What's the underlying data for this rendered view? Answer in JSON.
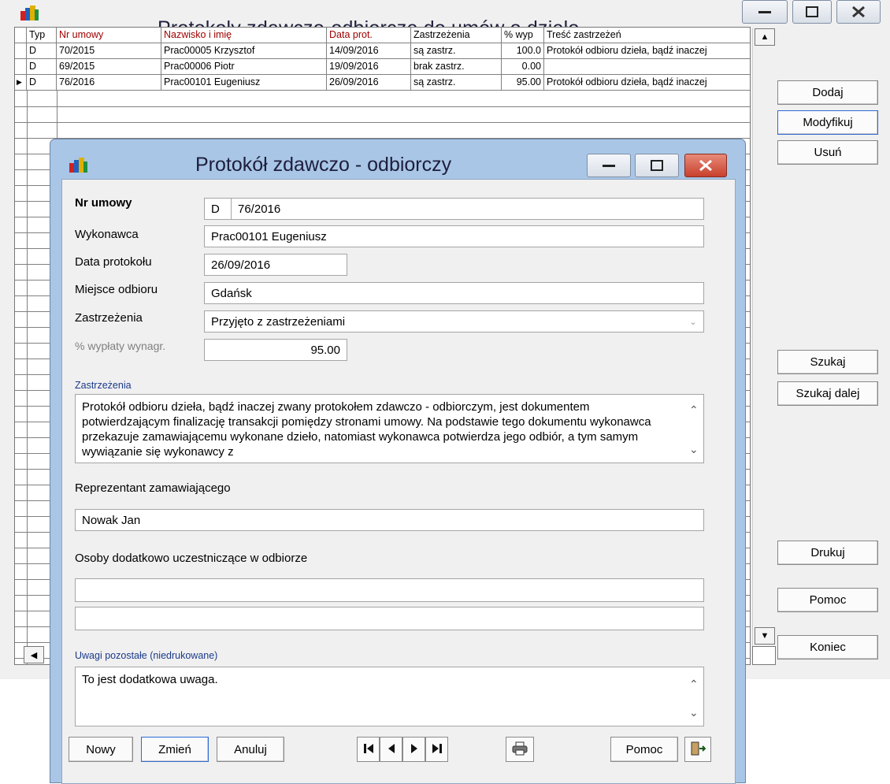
{
  "main": {
    "title": "Protokoły zdawczo-odbiorcze do umów o dzieło",
    "columns": [
      "Typ",
      "Nr umowy",
      "Nazwisko i imię",
      "Data prot.",
      "Zastrzeżenia",
      "% wyp",
      "Treść zastrzeżeń"
    ],
    "rows": [
      {
        "typ": "D",
        "nr": "70/2015",
        "name": "Prac00005 Krzysztof",
        "date": "14/09/2016",
        "zastrz": "są zastrz.",
        "pct": "100.0",
        "tresc": "Protokół odbioru dzieła, bądź inaczej"
      },
      {
        "typ": "D",
        "nr": "69/2015",
        "name": "Prac00006 Piotr",
        "date": "19/09/2016",
        "zastrz": "brak zastrz.",
        "pct": "0.00",
        "tresc": ""
      },
      {
        "typ": "D",
        "nr": "76/2016",
        "name": "Prac00101 Eugeniusz",
        "date": "26/09/2016",
        "zastrz": "są zastrz.",
        "pct": "95.00",
        "tresc": "Protokół odbioru dzieła, bądź inaczej"
      }
    ],
    "buttons": {
      "dodaj": "Dodaj",
      "modyfikuj": "Modyfikuj",
      "usun": "Usuń",
      "szukaj": "Szukaj",
      "szukaj_dalej": "Szukaj dalej",
      "drukuj": "Drukuj",
      "pomoc": "Pomoc",
      "koniec": "Koniec"
    }
  },
  "dialog": {
    "title": "Protokół zdawczo - odbiorczy",
    "labels": {
      "nr_umowy": "Nr umowy",
      "wykonawca": "Wykonawca",
      "data": "Data protokołu",
      "miejsce": "Miejsce odbioru",
      "zastrzezenia": "Zastrzeżenia",
      "procent": "% wypłaty wynagr."
    },
    "values": {
      "typ": "D",
      "nr_umowy": "76/2016",
      "wykonawca": "Prac00101 Eugeniusz",
      "data": "26/09/2016",
      "miejsce": "Gdańsk",
      "zastrzezenia": "Przyjęto z zastrzeżeniami",
      "procent": "95.00"
    },
    "zastrzezenia_section": "Zastrzeżenia",
    "zastrzezenia_text": "Protokół odbioru dzieła, bądź inaczej zwany protokołem zdawczo - odbiorczym, jest dokumentem potwierdzającym finalizację transakcji pomiędzy stronami umowy. Na podstawie tego dokumentu wykonawca przekazuje zamawiającemu wykonane dzieło, natomiast wykonawca potwierdza jego odbiór, a tym samym wywiązanie się wykonawcy z",
    "reprezentant_label": "Reprezentant zamawiającego",
    "reprezentant_value": "Nowak Jan",
    "osoby_label": "Osoby dodatkowo uczestniczące w odbiorze",
    "osoby_1": "",
    "osoby_2": "",
    "uwagi_section": "Uwagi pozostałe (niedrukowane)",
    "uwagi_text": "To jest dodatkowa uwaga.",
    "buttons": {
      "nowy": "Nowy",
      "zmien": "Zmień",
      "anuluj": "Anuluj",
      "pomoc": "Pomoc"
    }
  }
}
